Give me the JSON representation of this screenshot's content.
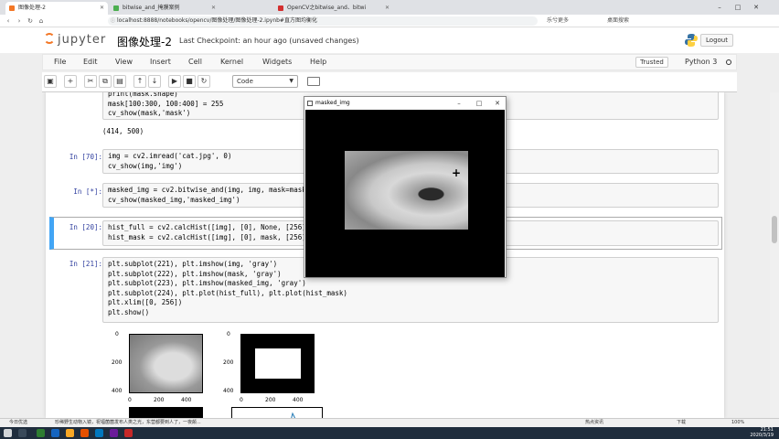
{
  "browser": {
    "tabs": [
      {
        "label": "图像处理-2",
        "active": true
      },
      {
        "label": "bitwise_and_掩膜案例",
        "active": false
      },
      {
        "label": "OpenCV之bitwise_and、bitwi",
        "active": false
      }
    ],
    "url": "localhost:8888/notebooks/opencv/图像处理/图像处理-2.ipynb#直方图均衡化",
    "ext_label": "乐兮更多",
    "user_label": "桌面搜索"
  },
  "jupyter": {
    "logo": "jupyter",
    "title": "图像处理-2",
    "checkpoint": "Last Checkpoint: an hour ago  (unsaved changes)",
    "logout": "Logout",
    "menus": [
      "File",
      "Edit",
      "View",
      "Insert",
      "Cell",
      "Kernel",
      "Widgets",
      "Help"
    ],
    "trusted": "Trusted",
    "kernel": "Python 3",
    "cell_type": "Code"
  },
  "cells": [
    {
      "prompt": "",
      "code": "print(mask.shape)\nmask[100:300, 100:400] = 255\ncv_show(mask,'mask')",
      "output": "(414, 500)"
    },
    {
      "prompt": "In [70]:",
      "code": "img = cv2.imread('cat.jpg', 0)\ncv_show(img,'img')"
    },
    {
      "prompt": "In [*]:",
      "code": "masked_img = cv2.bitwise_and(img, img, mask=mask)\ncv_show(masked_img,'masked_img')"
    },
    {
      "prompt": "In [20]:",
      "code": "hist_full = cv2.calcHist([img], [0], None, [256], [0, 256])\nhist_mask = cv2.calcHist([img], [0], mask, [256], [0, 256])"
    },
    {
      "prompt": "In [21]:",
      "code": "plt.subplot(221), plt.imshow(img, 'gray')\nplt.subplot(222), plt.imshow(mask, 'gray')\nplt.subplot(223), plt.imshow(masked_img, 'gray')\nplt.subplot(224), plt.plot(hist_full), plt.plot(hist_mask)\nplt.xlim([0, 256])\nplt.show()"
    }
  ],
  "plots": {
    "ticks_y": [
      "0",
      "200",
      "400"
    ],
    "ticks_x": [
      "0",
      "200",
      "400"
    ]
  },
  "cvwindow": {
    "title": "masked_img"
  },
  "statusbar": {
    "left": "今日优选",
    "news": "珍稀野生动物入镜，祝福菌菌发布人类之光，东营都要到人了，一夜颠...",
    "right": [
      "热点资讯",
      "下载",
      "100%"
    ]
  },
  "taskbar": {
    "time": "21:51",
    "date": "2020/3/19"
  }
}
